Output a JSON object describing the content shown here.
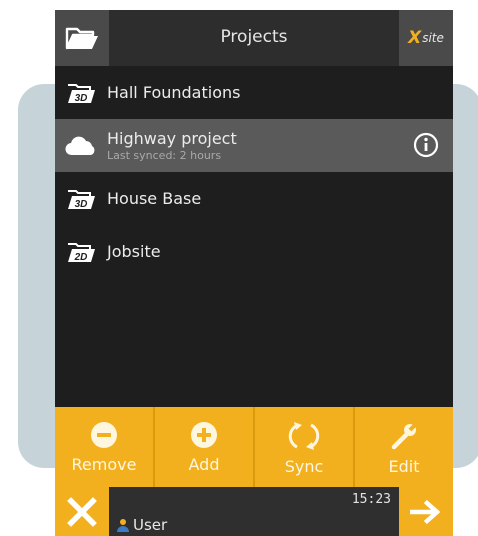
{
  "header": {
    "title": "Projects",
    "logo_x": "X",
    "logo_text": "site",
    "folder_icon": "folder-open-icon"
  },
  "projects": [
    {
      "name": "Hall Foundations",
      "icon": "3D",
      "subtitle": ""
    },
    {
      "name": "Highway project",
      "icon": "cloud",
      "subtitle": "Last synced: 2 hours"
    },
    {
      "name": "House Base",
      "icon": "3D",
      "subtitle": ""
    },
    {
      "name": "Jobsite",
      "icon": "2D",
      "subtitle": ""
    }
  ],
  "toolbar": {
    "remove": "Remove",
    "add": "Add",
    "sync": "Sync",
    "edit": "Edit"
  },
  "status": {
    "time": "15:23",
    "user": "User"
  },
  "colors": {
    "accent": "#f2b01e",
    "background": "#1e1e1e",
    "selected": "#5a5a5a"
  }
}
